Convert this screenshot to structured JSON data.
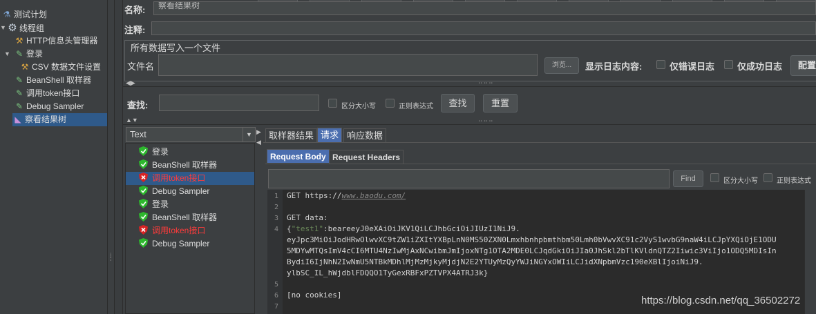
{
  "tree": {
    "items": [
      {
        "label": "测试计划",
        "icon": "flask-icon"
      },
      {
        "label": "线程组",
        "icon": "gear-icon"
      },
      {
        "label": "HTTP信息头管理器",
        "icon": "wrench-icon"
      },
      {
        "label": "登录",
        "icon": "sampler-icon"
      },
      {
        "label": "CSV 数据文件设置",
        "icon": "wrench-icon"
      },
      {
        "label": "BeanShell 取样器",
        "icon": "sampler-icon"
      },
      {
        "label": "调用token接口",
        "icon": "sampler-icon"
      },
      {
        "label": "Debug Sampler",
        "icon": "sampler-icon"
      },
      {
        "label": "察看结果树",
        "icon": "chart-icon"
      }
    ]
  },
  "form": {
    "name_label": "名称:",
    "name_value": "察看结果树",
    "comment_label": "注释:",
    "file_section_title": "所有数据写入一个文件",
    "filename_label": "文件名",
    "browse_button": "浏览...",
    "log_display_label": "显示日志内容:",
    "errors_only_label": "仅错误日志",
    "success_only_label": "仅成功日志",
    "configure_button": "配置"
  },
  "search": {
    "label": "查找:",
    "case_sensitive_label": "区分大小写",
    "regex_label": "正则表达式",
    "find_button": "查找",
    "reset_button": "重置"
  },
  "renderer": {
    "selected": "Text"
  },
  "results": [
    {
      "label": "登录",
      "status": "ok"
    },
    {
      "label": "BeanShell 取样器",
      "status": "ok"
    },
    {
      "label": "调用token接口",
      "status": "error"
    },
    {
      "label": "Debug Sampler",
      "status": "ok"
    },
    {
      "label": "登录",
      "status": "ok"
    },
    {
      "label": "BeanShell 取样器",
      "status": "ok"
    },
    {
      "label": "调用token接口",
      "status": "error"
    },
    {
      "label": "Debug Sampler",
      "status": "ok"
    }
  ],
  "result_tabs": [
    "取样器结果",
    "请求",
    "响应数据"
  ],
  "request_subtabs": [
    "Request Body",
    "Request Headers"
  ],
  "body_search": {
    "find_button": "Find",
    "case_sensitive_label": "区分大小写",
    "regex_label": "正则表达式"
  },
  "body": {
    "line_numbers": [
      "1",
      "2",
      "3",
      "4",
      "5",
      "6",
      "7"
    ],
    "line1_prefix": "GET https://",
    "line1_url": "www.baodu.com/",
    "line3": "GET data:",
    "line4a_open": "{",
    "line4a_key": "\"test1\"",
    "line4a_rest": ":beareeyJ0eXAiOiJKV1QiLCJhbGciOiJIUzI1NiJ9.",
    "line4b": "eyJpc3MiOiJodHRwOlwvXC9tZW1iZXItYXBpLnN0MS50ZXN0Lmxhbnhpbmthbm50Lmh0bVwvXC91c2VyS1wvbG9naW4iLCJpYXQiOjE1ODU",
    "line4c": "5MDYwMTQsImV4cCI6MTU4NzIwMjAxNCwibmJmIjoxNTg1OTA2MDE0LCJqdGkiOiJIa0JhSkl2bTlKVldnQTZ2Iiwic3ViIjo1ODQ5MDIsIn",
    "line4d": "BydiI6IjNhN2IwNmU5NTBkMDhlMjMzMjkyMjdjN2E2YTUyMzQyYWJiNGYxOWIiLCJidXNpbmVzc190eXBlIjoiNiJ9.",
    "line4e": "ylbSC_IL_hWjdblFDQQO1TyGexRBFxPZTVPX4ATRJ3k}",
    "line6": "[no cookies]"
  },
  "watermark": "https://blog.csdn.net/qq_36502272",
  "colors": {
    "background": "#3c3f41",
    "selection": "#2f5a8a",
    "active_tab": "#4b6eaf",
    "error_text": "#ff3b3b",
    "ok_shield": "#2db82d",
    "error_shield": "#d92323"
  }
}
